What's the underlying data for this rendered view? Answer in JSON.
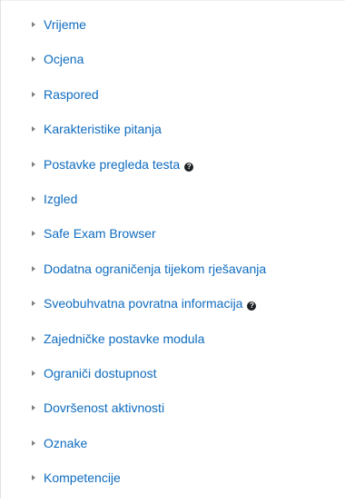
{
  "sections": [
    {
      "label": "Vrijeme"
    },
    {
      "label": "Ocjena"
    },
    {
      "label": "Raspored"
    },
    {
      "label": "Karakteristike pitanja"
    },
    {
      "label": "Postavke pregleda testa",
      "help": "?"
    },
    {
      "label": "Izgled"
    },
    {
      "label": "Safe Exam Browser"
    },
    {
      "label": "Dodatna ograničenja tijekom rješavanja"
    },
    {
      "label": "Sveobuhvatna povratna informacija",
      "help": "?"
    },
    {
      "label": "Zajedničke postavke modula"
    },
    {
      "label": "Ograniči dostupnost"
    },
    {
      "label": "Dovršenost aktivnosti"
    },
    {
      "label": "Oznake"
    },
    {
      "label": "Kompetencije"
    }
  ],
  "colors": {
    "link": "#0f6cbf",
    "caret": "#7f7f7f",
    "help_icon": "#1d2125"
  },
  "icons": {
    "collapsed": "caret-right-icon",
    "help": "question-circle-icon"
  }
}
